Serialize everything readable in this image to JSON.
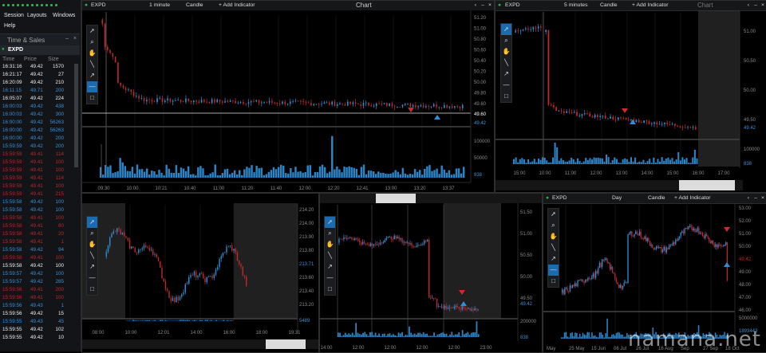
{
  "menu": {
    "session": "Session",
    "layouts": "Layouts",
    "windows": "Windows",
    "help": "Help"
  },
  "time_sales": {
    "title": "Time & Sales",
    "symbol": "EXPD",
    "headers": [
      "Time",
      "Price",
      "Size"
    ],
    "rows": [
      [
        "16:31:16",
        "49.42",
        "1570",
        "w"
      ],
      [
        "16:21:17",
        "49.42",
        "27",
        "w"
      ],
      [
        "16:20:09",
        "49.42",
        "210",
        "w"
      ],
      [
        "16:11:15",
        "49.71",
        "200",
        "b"
      ],
      [
        "16:05:07",
        "49.42",
        "224",
        "w"
      ],
      [
        "16:00:03",
        "49.42",
        "438",
        "b"
      ],
      [
        "16:00:03",
        "49.42",
        "300",
        "b"
      ],
      [
        "16:00:00",
        "49.42",
        "56263",
        "b"
      ],
      [
        "16:00:00",
        "49.42",
        "56263",
        "b"
      ],
      [
        "16:00:00",
        "49.42",
        "200",
        "b"
      ],
      [
        "15:59:59",
        "49.42",
        "200",
        "b"
      ],
      [
        "15:59:59",
        "49.41",
        "114",
        "r"
      ],
      [
        "15:59:59",
        "49.41",
        "100",
        "r"
      ],
      [
        "15:59:59",
        "49.41",
        "100",
        "r"
      ],
      [
        "15:59:59",
        "49.41",
        "114",
        "r"
      ],
      [
        "15:59:59",
        "49.41",
        "100",
        "r"
      ],
      [
        "15:59:59",
        "49.41",
        "215",
        "r"
      ],
      [
        "15:59:58",
        "49.42",
        "100",
        "b"
      ],
      [
        "15:59:58",
        "49.42",
        "100",
        "b"
      ],
      [
        "15:59:58",
        "49.41",
        "100",
        "r"
      ],
      [
        "15:59:58",
        "49.41",
        "80",
        "r"
      ],
      [
        "15:59:58",
        "49.41",
        "20",
        "r"
      ],
      [
        "15:59:58",
        "49.41",
        "1",
        "r"
      ],
      [
        "15:59:58",
        "49.42",
        "94",
        "b"
      ],
      [
        "15:59:58",
        "49.41",
        "100",
        "r"
      ],
      [
        "15:59:58",
        "49.42",
        "100",
        "w"
      ],
      [
        "15:59:57",
        "49.42",
        "100",
        "b"
      ],
      [
        "15:59:57",
        "49.42",
        "285",
        "b"
      ],
      [
        "15:59:56",
        "49.41",
        "200",
        "r"
      ],
      [
        "15:59:56",
        "49.41",
        "100",
        "r"
      ],
      [
        "15:59:56",
        "49.43",
        "1",
        "b"
      ],
      [
        "15:59:56",
        "49.42",
        "15",
        "w"
      ],
      [
        "15:59:55",
        "49.43",
        "45",
        "b"
      ],
      [
        "15:59:55",
        "49.42",
        "102",
        "w"
      ],
      [
        "15:59:55",
        "49.42",
        "10",
        "w"
      ]
    ]
  },
  "colors": {
    "up": "#2f8fd4",
    "down": "#c0282c",
    "neutral": "#e8e8e8",
    "text_blue": "#3d8fd6",
    "text_red": "#b82a2e"
  },
  "chart1": {
    "symbol": "EXPD",
    "interval": "1 minute",
    "type": "Candle",
    "add": "+ Add Indicator",
    "title": "Chart",
    "y_ticks": [
      "51.20",
      "51.00",
      "50.80",
      "50.60",
      "50.40",
      "50.20",
      "50.00",
      "49.80",
      "49.60"
    ],
    "last": "49.60",
    "last2": "49.42",
    "vol_ticks": [
      "100000",
      "50000"
    ],
    "vol_last": "838",
    "x_ticks": [
      "09:30",
      "10:00",
      "10:21",
      "10:40",
      "11:00",
      "11:20",
      "11:40",
      "12:00",
      "12:20",
      "12:41",
      "13:00",
      "13:20",
      "13:37"
    ]
  },
  "chart2": {
    "symbol": "EXPD",
    "interval": "5 minutes",
    "type": "Candle",
    "add": "+ Add Indicator",
    "title": "Chart",
    "y_ticks": [
      "51.00",
      "50.50",
      "50.00",
      "49.50"
    ],
    "last": "49.42",
    "vol_ticks": [
      "100000"
    ],
    "vol_last": "838",
    "x_ticks": [
      "15:00",
      "10:00",
      "11:00",
      "12:00",
      "13:00",
      "14:00",
      "15:00",
      "16:00",
      "17:00"
    ]
  },
  "chart3": {
    "y_ticks": [
      "214.20",
      "214.00",
      "213.90",
      "213.80",
      "213.71",
      "213.60",
      "213.40",
      "213.20"
    ],
    "vol_last": "5489",
    "x_ticks": [
      "08:00",
      "10:00",
      "12:01",
      "14:00",
      "16:00",
      "18:00",
      "19:31"
    ]
  },
  "chart4": {
    "y_ticks": [
      "51.50",
      "51.00",
      "50.50",
      "50.00",
      "49.50"
    ],
    "last": "49.42",
    "vol_ticks": [
      "200000"
    ],
    "vol_last": "838",
    "x_ticks": [
      "14:00",
      "12:00",
      "12:00",
      "12:00",
      "12:00",
      "23:00"
    ]
  },
  "chart5": {
    "symbol": "EXPD",
    "interval": "Day",
    "type": "Candle",
    "add": "+ Add Indicator",
    "y_ticks": [
      "53.00",
      "52.00",
      "51.00",
      "50.00",
      "49.42",
      "49.00",
      "48.00",
      "47.00",
      "46.00"
    ],
    "last": "49.42",
    "vol_ticks": [
      "5000000"
    ],
    "vol_last": "1893443",
    "x_ticks": [
      "May",
      "25 May",
      "15 Jun",
      "06 Jul",
      "26 Jul",
      "16 Aug",
      "Sep",
      "27 Sep",
      "18 Oct"
    ]
  },
  "watermark": "namana.net"
}
